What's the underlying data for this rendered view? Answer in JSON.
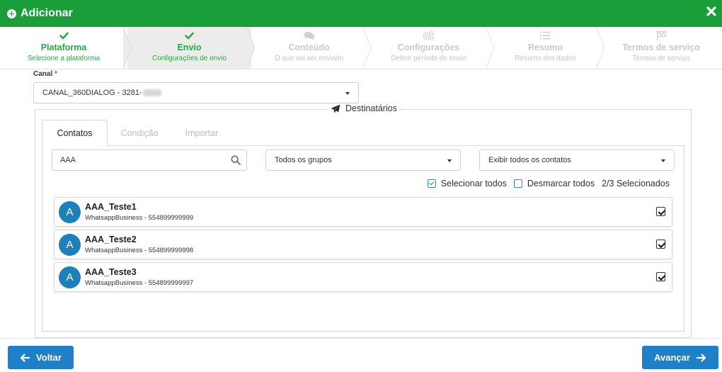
{
  "header": {
    "title": "Adicionar"
  },
  "steps": [
    {
      "name": "Plataforma",
      "sub": "Selecione a plataforma",
      "state": "done",
      "icon": "check-icon"
    },
    {
      "name": "Envio",
      "sub": "Configurações de envio",
      "state": "active",
      "icon": "check-icon"
    },
    {
      "name": "Conteúdo",
      "sub": "O que vai ser enviado",
      "state": "todo",
      "icon": "comments-icon"
    },
    {
      "name": "Configurações",
      "sub": "Definir período de envio",
      "state": "todo",
      "icon": "gears-icon"
    },
    {
      "name": "Resumo",
      "sub": "Resumo dos dados",
      "state": "todo",
      "icon": "list-icon"
    },
    {
      "name": "Termos de serviço",
      "sub": "Termos de serviço",
      "state": "todo",
      "icon": "flag-checkered-icon"
    }
  ],
  "canal": {
    "label": "Canal",
    "required_mark": "*",
    "value": "CANAL_360DIALOG - 3281-"
  },
  "destinatarios": {
    "legend": "Destinatários",
    "tabs": [
      {
        "label": "Contatos",
        "active": true
      },
      {
        "label": "Condição",
        "active": false
      },
      {
        "label": "Importar",
        "active": false
      }
    ],
    "search_value": "AAA",
    "grupos_select": "Todos os grupos",
    "exibir_select": "Exibir todos os contatos",
    "select_all_label": "Selecionar todos",
    "deselect_all_label": "Desmarcar todos",
    "selected_count": "2/3 Selecionados",
    "contacts": [
      {
        "initial": "A",
        "name": "AAA_Teste1",
        "info": "WhatsappBusiness - 554899999999",
        "checked": true
      },
      {
        "initial": "A",
        "name": "AAA_Teste2",
        "info": "WhatsappBusiness - 554899999998",
        "checked": true
      },
      {
        "initial": "A",
        "name": "AAA_Teste3",
        "info": "WhatsappBusiness - 554899999997",
        "checked": true
      }
    ]
  },
  "footer": {
    "back_label": "Voltar",
    "next_label": "Avançar"
  },
  "colors": {
    "header_green": "#1a9e3a",
    "step_done_green": "#2aa845",
    "primary_blue": "#1f7fc7",
    "avatar_blue": "#1f7fb8"
  }
}
